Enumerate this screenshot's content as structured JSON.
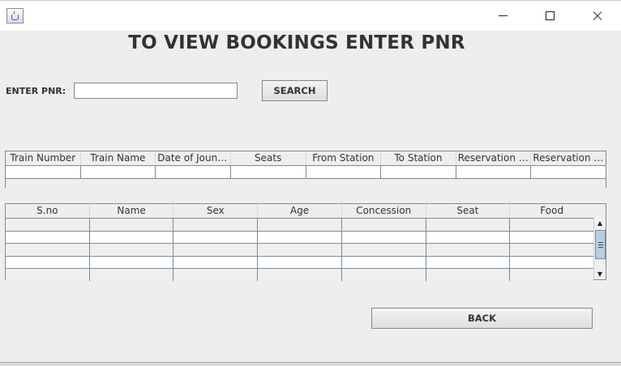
{
  "window": {
    "controls": {
      "minimize_icon": "minimize-icon",
      "maximize_icon": "maximize-icon",
      "close_icon": "close-icon"
    }
  },
  "page": {
    "heading": "TO VIEW BOOKINGS ENTER PNR"
  },
  "pnr": {
    "label": "ENTER PNR:",
    "value": "",
    "placeholder": ""
  },
  "buttons": {
    "search": "SEARCH",
    "back": "BACK"
  },
  "booking_table": {
    "columns": [
      "Train Number",
      "Train Name",
      "Date of Jouney",
      "Seats",
      "From Station",
      "To Station",
      "Reservation Fr...",
      "Reservation U..."
    ]
  },
  "passenger_table": {
    "columns": [
      "S.no",
      "Name",
      "Sex",
      "Age",
      "Concession",
      "Seat",
      "Food"
    ]
  },
  "colors": {
    "background": "#eeeeee",
    "scroll_thumb": "#b8cce4",
    "grid": "#7a8a99"
  }
}
